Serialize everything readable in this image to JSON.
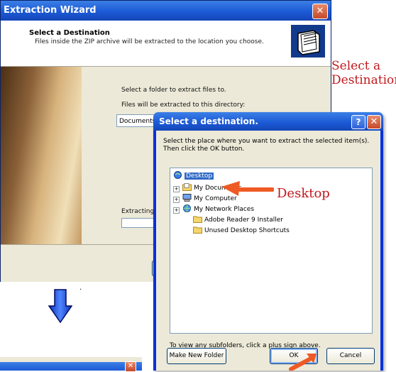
{
  "wizard": {
    "title": "Extraction Wizard",
    "header_title": "Select a Destination",
    "header_subtitle": "Files inside the ZIP archive will be extracted to the location you choose.",
    "select_folder_label": "Select a folder to extract files to.",
    "extract_to_label": "Files will be extracted to this directory:",
    "directory_value": "Documents",
    "extracting_label": "Extracting..."
  },
  "annotations": {
    "select_destination": [
      "Select a",
      "Destination"
    ],
    "desktop_callout": "Desktop"
  },
  "dialog": {
    "title": "Select a destination.",
    "instructions": "Select the place where you want to extract the selected item(s).  Then click the OK button.",
    "tree": [
      {
        "label": "Desktop",
        "icon": "desktop-icon",
        "selected": true
      },
      {
        "label": "My Documents",
        "icon": "my-documents-icon",
        "expandable": true
      },
      {
        "label": "My Computer",
        "icon": "my-computer-icon",
        "expandable": true
      },
      {
        "label": "My Network Places",
        "icon": "network-places-icon",
        "expandable": true
      },
      {
        "label": "Adobe Reader 9 Installer",
        "icon": "folder-icon"
      },
      {
        "label": "Unused Desktop Shortcuts",
        "icon": "folder-icon"
      }
    ],
    "hint": "To view any subfolders, click a plus sign above.",
    "make_new_folder": "Make New Folder",
    "ok": "OK",
    "cancel": "Cancel"
  },
  "colors": {
    "annotation_red": "#c0191c",
    "callout_arrow": "#ee5a24",
    "xp_blue": "#0831d9",
    "selection": "#316ac5"
  }
}
